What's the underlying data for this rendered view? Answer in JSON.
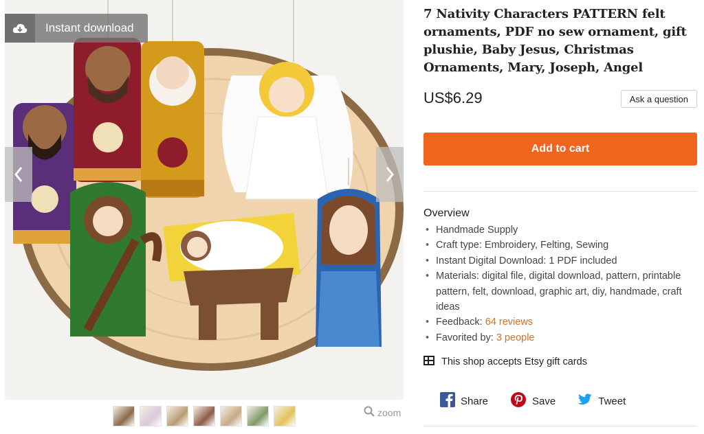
{
  "gallery": {
    "badge_label": "Instant download",
    "zoom_label": "zoom",
    "thumbnails": [
      {
        "name": "thumb-1",
        "color": "#8a6a4a"
      },
      {
        "name": "thumb-2",
        "color": "#d8c9d9"
      },
      {
        "name": "thumb-3",
        "color": "#b79b72"
      },
      {
        "name": "thumb-4",
        "color": "#8f5a48"
      },
      {
        "name": "thumb-5",
        "color": "#c6aa86"
      },
      {
        "name": "thumb-6",
        "color": "#7e9a6b"
      },
      {
        "name": "thumb-7",
        "color": "#e2c25a"
      }
    ],
    "icons": {
      "badge": "cloud-download-icon",
      "prev": "chevron-left-icon",
      "next": "chevron-right-icon",
      "zoom": "magnifier-icon"
    }
  },
  "listing": {
    "title": "7 Nativity Characters PATTERN felt ornaments, PDF no sew ornament, gift plushie, Baby Jesus, Christmas Ornaments, Mary, Joseph, Angel",
    "price": "US$6.29",
    "ask_label": "Ask a question",
    "cart_label": "Add to cart"
  },
  "overview": {
    "heading": "Overview",
    "items": [
      {
        "text": "Handmade Supply"
      },
      {
        "text": "Craft type: Embroidery, Felting, Sewing"
      },
      {
        "text": "Instant Digital Download: 1 PDF included"
      },
      {
        "text": "Materials: digital file, digital download, pattern, printable pattern, felt, download, graphic art, diy, handmade, craft ideas"
      }
    ],
    "feedback_label": "Feedback: ",
    "feedback_link": "64 reviews",
    "favorited_label": "Favorited by: ",
    "favorited_link": "3 people",
    "gift_text": "This shop accepts Etsy gift cards"
  },
  "share": {
    "facebook": "Share",
    "pinterest": "Save",
    "twitter": "Tweet"
  },
  "colors": {
    "accent": "#f1641e",
    "link": "#d76f1f",
    "facebook": "#3b5998",
    "pinterest": "#bd081c",
    "twitter": "#1da1f2"
  }
}
